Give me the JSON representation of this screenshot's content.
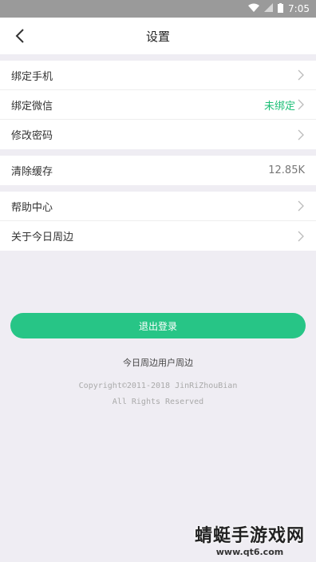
{
  "status_bar": {
    "time": "7:05"
  },
  "nav": {
    "title": "设置"
  },
  "group1": [
    {
      "label": "绑定手机",
      "value": ""
    },
    {
      "label": "绑定微信",
      "value": "未绑定"
    },
    {
      "label": "修改密码",
      "value": ""
    }
  ],
  "group2": [
    {
      "label": "清除缓存",
      "value": "12.85K"
    }
  ],
  "group3": [
    {
      "label": "帮助中心",
      "value": ""
    },
    {
      "label": "关于今日周边",
      "value": ""
    }
  ],
  "logout_label": "退出登录",
  "footer": {
    "title": "今日周边用户周边",
    "copyright_line1": "Copyright©2011-2018 JinRiZhouBian",
    "copyright_line2": "All Rights Reserved"
  },
  "watermark": {
    "name": "蜻蜓手游戏网",
    "url": "www.qt6.com"
  },
  "colors": {
    "accent": "#27c586",
    "unbound": "#1dbf77",
    "background": "#efedf3"
  }
}
